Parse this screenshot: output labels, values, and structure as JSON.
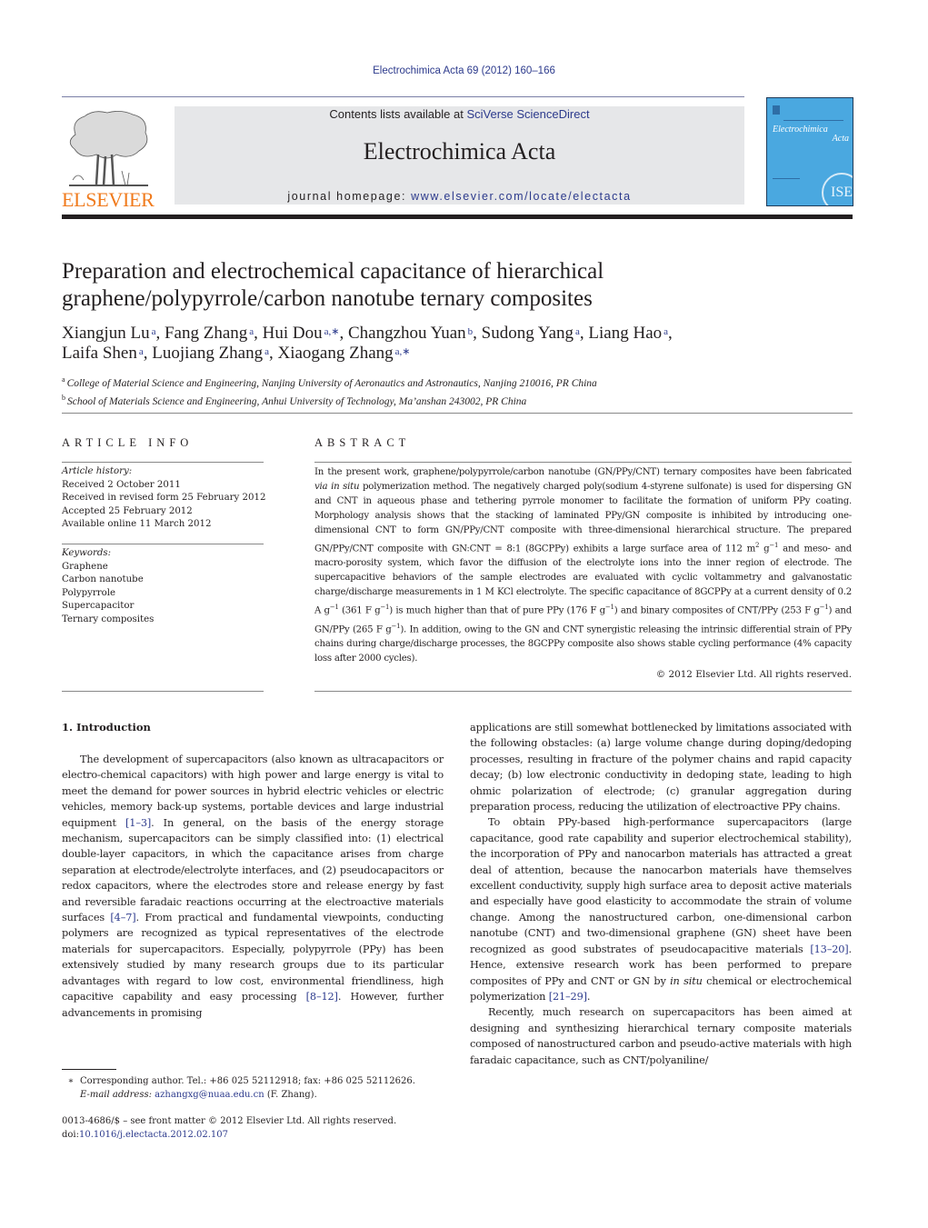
{
  "header": {
    "citation": "Electrochimica Acta 69 (2012) 160–166",
    "contents_prefix": "Contents lists available at ",
    "contents_link": "SciVerse ScienceDirect",
    "journal_title": "Electrochimica Acta",
    "homepage_prefix": "journal homepage: ",
    "homepage_link": "www.elsevier.com/locate/electacta",
    "publisher_logo_text": "ELSEVIER",
    "cover": {
      "title_line1": "Electrochimica",
      "title_line2": "Acta",
      "society_badge": "ISE",
      "color": "#4aa8e0"
    },
    "accent_color": "#f07a1c",
    "link_color": "#2c3a8c"
  },
  "article": {
    "title_line1": "Preparation and electrochemical capacitance of hierarchical",
    "title_line2": "graphene/polypyrrole/carbon nanotube ternary composites",
    "authors": [
      {
        "name": "Xiangjun Lu",
        "sup": "a",
        "sep": ", "
      },
      {
        "name": "Fang Zhang",
        "sup": "a",
        "sep": ", "
      },
      {
        "name": "Hui Dou",
        "sup": "a,∗",
        "sep": ", "
      },
      {
        "name": "Changzhou Yuan",
        "sup": "b",
        "sep": ", "
      },
      {
        "name": "Sudong Yang",
        "sup": "a",
        "sep": ", "
      },
      {
        "name": "Liang Hao",
        "sup": "a",
        "sep": ","
      },
      {
        "name": "Laifa Shen",
        "sup": "a",
        "sep": ", "
      },
      {
        "name": "Luojiang Zhang",
        "sup": "a",
        "sep": ", "
      },
      {
        "name": "Xiaogang Zhang",
        "sup": "a,∗",
        "sep": ""
      }
    ],
    "affiliations": [
      {
        "mark": "a",
        "text": "College of Material Science and Engineering, Nanjing University of Aeronautics and Astronautics, Nanjing 210016, PR China"
      },
      {
        "mark": "b",
        "text": "School of Materials Science and Engineering, Anhui University of Technology, Ma’anshan 243002, PR China"
      }
    ]
  },
  "article_info": {
    "heading": "ARTICLE INFO",
    "history_label": "Article history:",
    "history": [
      "Received 2 October 2011",
      "Received in revised form 25 February 2012",
      "Accepted 25 February 2012",
      "Available online 11 March 2012"
    ],
    "keywords_label": "Keywords:",
    "keywords": [
      "Graphene",
      "Carbon nanotube",
      "Polypyrrole",
      "Supercapacitor",
      "Ternary composites"
    ]
  },
  "abstract": {
    "heading": "ABSTRACT",
    "p1": "In the present work, graphene/polypyrrole/carbon nanotube (GN/PPy/CNT) ternary composites have been fabricated ",
    "p1_italic": "via in situ",
    "p2": " polymerization method. The negatively charged poly(sodium 4-styrene sulfonate) is used for dispersing GN and CNT in aqueous phase and tethering pyrrole monomer to facilitate the formation of uniform PPy coating. Morphology analysis shows that the stacking of laminated PPy/GN composite is inhibited by introducing one-dimensional CNT to form GN/PPy/CNT composite with three-dimensional hierarchical structure. The prepared GN/PPy/CNT composite with GN:CNT = 8:1 (8GCPPy) exhibits a large surface area of 112 m",
    "p3": " and meso- and macro-porosity system, which favor the diffusion of the electrolyte ions into the inner region of electrode. The supercapacitive behaviors of the sample electrodes are evaluated with cyclic voltammetry and galvanostatic charge/discharge measurements in 1 M KCl electrolyte. The specific capacitance of 8GCPPy at a current density of 0.2 A g",
    "p4": " (361 F g",
    "p5": ") is much higher than that of pure PPy (176 F g",
    "p6": ") and binary composites of CNT/PPy (253 F g",
    "p7": ") and GN/PPy (265 F g",
    "p8": "). In addition, owing to the GN and CNT synergistic releasing the intrinsic differential strain of PPy chains during charge/discharge processes, the 8GCPPy composite also shows stable cycling performance (4% capacity loss after 2000 cycles).",
    "sup_m2": "2",
    "g_unit": " g",
    "sup_minus1": "−1",
    "copyright": "© 2012 Elsevier Ltd. All rights reserved."
  },
  "body": {
    "section_heading": "1.  Introduction",
    "left": {
      "a": "The development of supercapacitors (also known as ultracapacitors or electro-chemical capacitors) with high power and large energy is vital to meet the demand for power sources in hybrid electric vehicles or electric vehicles, memory back-up systems, portable devices and large industrial equipment ",
      "ref1": "[1–3]",
      "b": ". In general, on the basis of the energy storage mechanism, supercapacitors can be simply classified into: (1) electrical double-layer capacitors, in which the capacitance arises from charge separation at electrode/electrolyte interfaces, and (2) pseudocapacitors or redox capacitors, where the electrodes store and release energy by fast and reversible faradaic reactions occurring at the electroactive materials surfaces ",
      "ref2": "[4–7]",
      "c": ". From practical and fundamental viewpoints, conducting polymers are recognized as typical representatives of the electrode materials for supercapacitors. Especially, polypyrrole (PPy) has been extensively studied by many research groups due to its particular advantages with regard to low cost, environmental friendliness, high capacitive capability and easy processing ",
      "ref3": "[8–12]",
      "d": ". However, further advancements in promising"
    },
    "right": {
      "p1": "applications are still somewhat bottlenecked by limitations associated with the following obstacles: (a) large volume change during doping/dedoping processes, resulting in fracture of the polymer chains and rapid capacity decay; (b) low electronic conductivity in dedoping state, leading to high ohmic polarization of electrode; (c) granular aggregation during preparation process, reducing the utilization of electroactive PPy chains.",
      "p2a": "To obtain PPy-based high-performance supercapacitors (large capacitance, good rate capability and superior electrochemical stability), the incorporation of PPy and nanocarbon materials has attracted a great deal of attention, because the nanocarbon materials have themselves excellent conductivity, supply high surface area to deposit active materials and especially have good elasticity to accommodate the strain of volume change. Among the nanostructured carbon, one-dimensional carbon nanotube (CNT) and two-dimensional graphene (GN) sheet have been recognized as good substrates of pseudocapacitive materials ",
      "ref4": "[13–20]",
      "p2b": ". Hence, extensive research work has been performed to prepare composites of PPy and CNT or GN by ",
      "p2_italic": "in situ",
      "p2c": " chemical or electrochemical polymerization ",
      "ref5": "[21–29]",
      "p2d": ".",
      "p3": "Recently, much research on supercapacitors has been aimed at designing and synthesizing hierarchical ternary composite materials composed of nanostructured carbon and pseudo-active materials with high faradaic capacitance, such as CNT/polyaniline/"
    }
  },
  "footnote": {
    "star": "∗",
    "line1": "Corresponding author. Tel.: +86 025 52112918; fax: +86 025 52112626.",
    "email_label": "E-mail address: ",
    "email": "azhangxg@nuaa.edu.cn",
    "email_suffix": " (F. Zhang).",
    "issn": "0013-4686/$ – see front matter © 2012 Elsevier Ltd. All rights reserved.",
    "doi_prefix": "doi:",
    "doi": "10.1016/j.electacta.2012.02.107"
  }
}
